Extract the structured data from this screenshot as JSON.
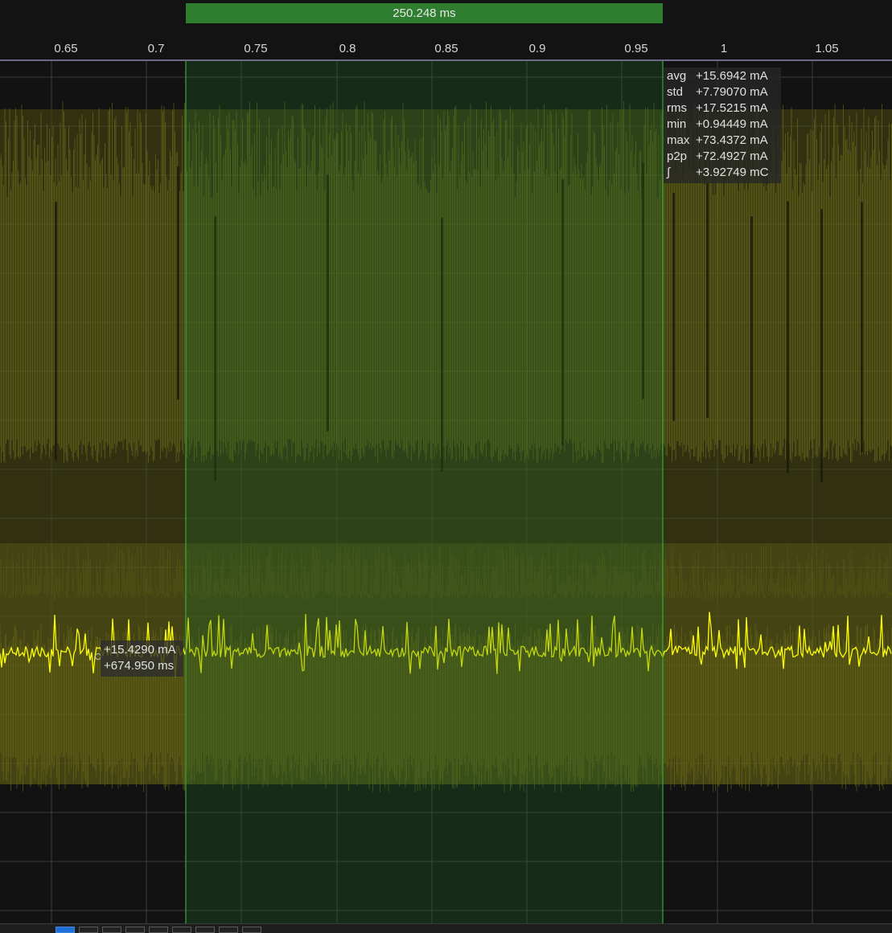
{
  "axis": {
    "ticks": [
      "0.65",
      "0.7",
      "0.75",
      "0.8",
      "0.85",
      "0.9",
      "0.95",
      "1",
      "1.05"
    ]
  },
  "selection": {
    "duration_label": "250.248 ms",
    "color": "#2f7d2f"
  },
  "stats": [
    {
      "name": "avg",
      "value": "+15.6942 mA"
    },
    {
      "name": "std",
      "value": "+7.79070 mA"
    },
    {
      "name": "rms",
      "value": "+17.5215 mA"
    },
    {
      "name": "min",
      "value": "+0.94449 mA"
    },
    {
      "name": "max",
      "value": "+73.4372 mA"
    },
    {
      "name": "p2p",
      "value": "+72.4927 mA"
    },
    {
      "name": "∫",
      "value": "+3.92749 mC"
    }
  ],
  "cursor": {
    "value": "+15.4290 mA",
    "time": "+674.950 ms"
  },
  "signal": {
    "trace_color": "#ffff00",
    "envelope_color": "#8a8a1c"
  },
  "scrollbar": {
    "segments": 9,
    "active_index": 0
  }
}
